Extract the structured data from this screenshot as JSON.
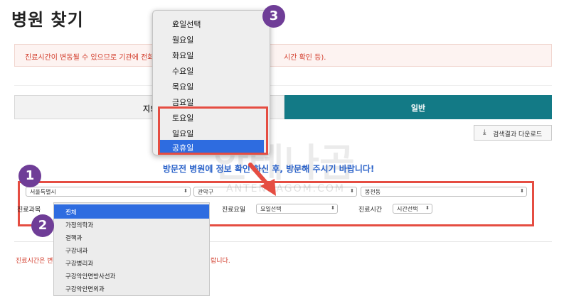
{
  "page": {
    "title": "병원 찾기"
  },
  "notice": {
    "text_left": "진료시간이 변동될 수 있으므로 기관에 전화",
    "text_right": "시간 확인 등)."
  },
  "tabs": [
    {
      "label": "지!"
    },
    {
      "label": "일반"
    }
  ],
  "download": {
    "label": "검색결과 다운로드",
    "icon": "download-icon"
  },
  "visit_message": "방문전 병원에 정보 확인 하신 후, 방문해 주시기 바랍니다!",
  "filters": {
    "region1": "서울특별시",
    "region2": "관악구",
    "region3": "봉천동",
    "subject_label": "진료과목",
    "subject_value": "전체",
    "day_label": "진료요일",
    "day_value": "요일선택",
    "time_label": "진료시간",
    "time_value": "시간선택"
  },
  "day_dropdown": {
    "items": [
      "요일선택",
      "월요일",
      "화요일",
      "수요일",
      "목요일",
      "금요일",
      "토요일",
      "일요일",
      "공휴일"
    ],
    "checked": "요일선택",
    "highlighted": "공휴일"
  },
  "subject_dropdown": {
    "items": [
      "전체",
      "가정의학과",
      "결핵과",
      "구강내과",
      "구강병리과",
      "구강악안면방사선과",
      "구강악안면외과"
    ],
    "checked": "전체"
  },
  "footer": {
    "left": "진료시간은 변",
    "right": "랍니다."
  },
  "badges": {
    "one": "1",
    "two": "2",
    "three": "3"
  },
  "watermark": {
    "text": "ANTENNAGOM.COM",
    "big": "안테나곰"
  },
  "colors": {
    "accent_red": "#e54d42",
    "badge_purple": "#6f3d97",
    "tab_teal": "#137a86",
    "highlight_blue": "#2e6ce0",
    "message_blue": "#2a62c9"
  }
}
